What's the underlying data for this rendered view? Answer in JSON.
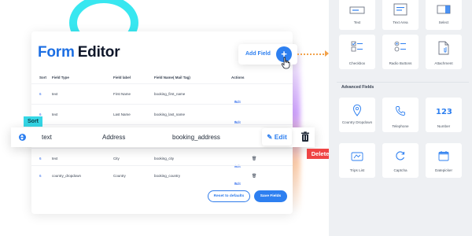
{
  "editor": {
    "title_part1": "Form",
    "title_part2": "Editor",
    "columns": [
      "Sort",
      "Field Type",
      "Field label",
      "Field Name( Mail Tag)",
      "Actions"
    ],
    "rows": [
      {
        "sort": "6",
        "type": "text",
        "label": "First Name",
        "name": "booking_first_name",
        "action": "Edit"
      },
      {
        "sort": "6",
        "type": "text",
        "label": "Last Name",
        "name": "booking_last_name",
        "action": "Edit"
      },
      {
        "sort": "6",
        "type": "email",
        "label": "Email",
        "name": "booking_email",
        "action": "Edit"
      },
      {
        "sort": "6",
        "type": "text",
        "label": "City",
        "name": "booking_city",
        "action": "Edit"
      },
      {
        "sort": "6",
        "type": "country_dropdown",
        "label": "Country",
        "name": "booking_country",
        "action": "Edit"
      }
    ],
    "reset_label": "Reset to defaults",
    "save_label": "Save Fields"
  },
  "add_field": {
    "label": "Add Field",
    "plus": "+"
  },
  "drag": {
    "sort_tag": "Sort",
    "type": "text",
    "label": "Address",
    "name": "booking_address",
    "edit_label": "Edit",
    "delete_label": "Delete"
  },
  "palette": {
    "basic": [
      {
        "label": "Text",
        "icon": "text-field-icon"
      },
      {
        "label": "Text Area",
        "icon": "textarea-icon"
      },
      {
        "label": "Select",
        "icon": "select-icon"
      },
      {
        "label": "Checkbox",
        "icon": "checkbox-icon"
      },
      {
        "label": "Radio Buttons",
        "icon": "radio-icon"
      },
      {
        "label": "Attachment",
        "icon": "attachment-icon"
      }
    ],
    "advanced_heading": "Advanced Fields",
    "advanced": [
      {
        "label": "Country Dropdown",
        "icon": "location-pin-icon"
      },
      {
        "label": "Telephone",
        "icon": "phone-icon"
      },
      {
        "label": "Number",
        "icon": "number-icon"
      },
      {
        "label": "Trips List",
        "icon": "trips-icon"
      },
      {
        "label": "Captcha",
        "icon": "captcha-icon"
      },
      {
        "label": "Datepicker",
        "icon": "calendar-icon"
      }
    ]
  },
  "colors": {
    "accent": "#2d7ff0",
    "sort_tag": "#35d7e6",
    "delete": "#ef4444",
    "connector": "#f2a24b"
  }
}
